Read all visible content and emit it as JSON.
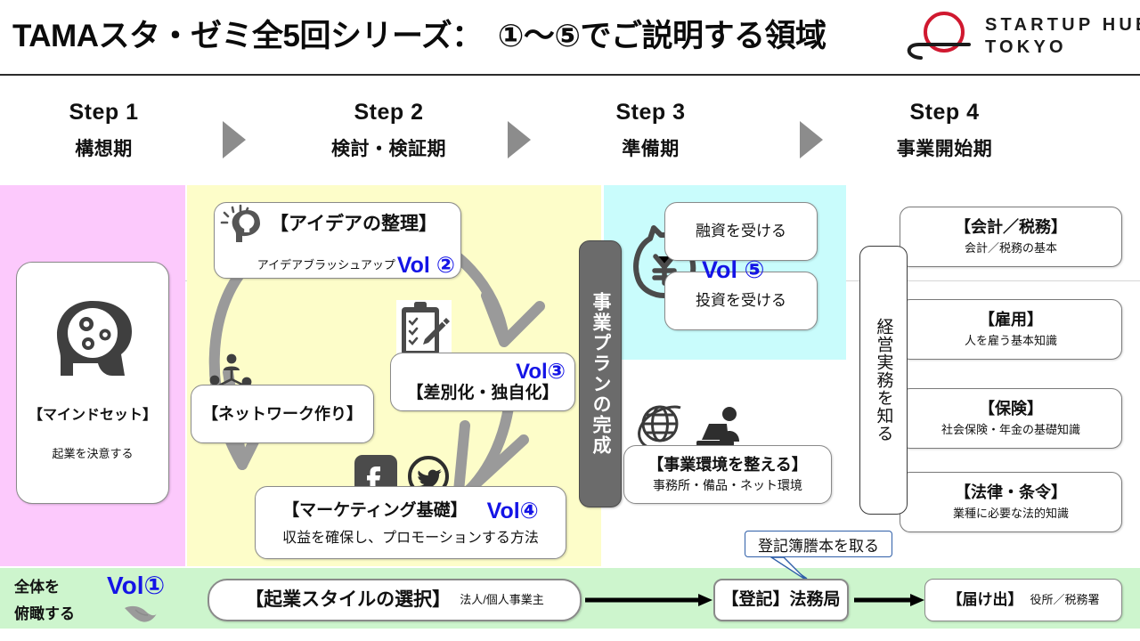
{
  "header": {
    "title": "TAMAスタ・ゼミ全5回シリーズ：　①～⑤でご説明する領域",
    "logo": {
      "line1": "STARTUP HUB",
      "line2": "TOKYO",
      "mark_color": "#d0182f"
    }
  },
  "colors": {
    "phase1": "#fcc9fc",
    "phase2": "#fdfdc9",
    "phase3": "#c9fcfc",
    "phase_overview": "#cdf5cd",
    "vol_text": "#1414e6",
    "arrow_gray": "#8c8c8c",
    "bizplan_bar": "#6b6b6b"
  },
  "steps": [
    {
      "name": "Step 1",
      "sub": "構想期"
    },
    {
      "name": "Step 2",
      "sub": "検討・検証期"
    },
    {
      "name": "Step 3",
      "sub": "準備期"
    },
    {
      "name": "Step 4",
      "sub": "事業開始期"
    }
  ],
  "step1": {
    "card": {
      "title": "【マインドセット】",
      "sub": "起業を決意する",
      "icon": "head-with-gears-icon"
    }
  },
  "step2": {
    "idea": {
      "title": "【アイデアの整理】",
      "sub": "アイデアブラッシュアップ",
      "vol": "Vol ②",
      "icon": "head-lightbulb-icon"
    },
    "network": {
      "title": "【ネットワーク作り】",
      "icon": "people-network-icon"
    },
    "differentiation": {
      "title": "【差別化・独自化】",
      "vol": "Vol③",
      "icon": "clipboard-pencil-icon"
    },
    "marketing": {
      "title": "【マーケティング基礎】",
      "vol": "Vol④",
      "sub": "収益を確保し、プロモーションする方法",
      "icons": [
        "facebook-icon",
        "twitter-icon"
      ]
    }
  },
  "bizplan_bar": {
    "label": "事業プランの完成"
  },
  "step3": {
    "money_icon": "money-bag-yen-icon",
    "loan": {
      "title": "融資を受ける"
    },
    "investment": {
      "title": "投資を受ける"
    },
    "vol": "Vol ⑤",
    "environment": {
      "title": "【事業環境を整える】",
      "sub": "事務所・備品・ネット環境",
      "icons": [
        "globe-icon",
        "person-laptop-icon"
      ]
    }
  },
  "step4": {
    "side_bar": {
      "label": "経営実務を知る"
    },
    "cards": [
      {
        "title": "【会計／税務】",
        "sub": "会計／税務の基本"
      },
      {
        "title": "【雇用】",
        "sub": "人を雇う基本知識"
      },
      {
        "title": "【保険】",
        "sub": "社会保険・年金の基礎知識"
      },
      {
        "title": "【法律・条令】",
        "sub": "業種に必要な法的知識"
      }
    ]
  },
  "overview_band": {
    "label_line1": "全体を",
    "label_line2": "俯瞰する",
    "vol": "Vol①",
    "bird_icon": "bird-icon",
    "style_card": {
      "title": "【起業スタイルの選択】",
      "sub": "法人/個人事業主"
    },
    "registration_card": {
      "title": "【登記】法務局"
    },
    "notify_card": {
      "title": "【届け出】",
      "sub": "役所／税務署"
    },
    "callout": {
      "text": "登記簿謄本を取る"
    }
  }
}
